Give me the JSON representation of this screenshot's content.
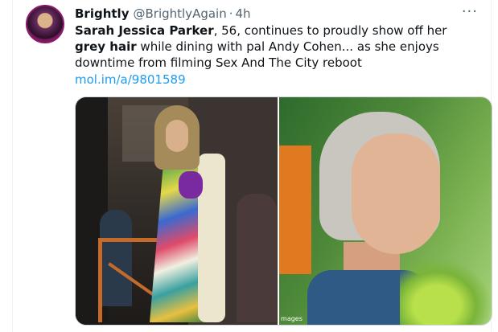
{
  "tweet": {
    "author_name": "Brightly",
    "author_handle": "@BrightlyAgain",
    "separator": "·",
    "timestamp": "4h",
    "more_label": "···",
    "text": {
      "p1_bold": "Sarah Jessica Parker",
      "p2": ", 56, continues to proudly show off her ",
      "p3_bold": "grey hair",
      "p4": " while dining with pal Andy Cohen... as she enjoys downtime from filming Sex And The City reboot"
    },
    "link": "mol.im/a/9801589",
    "media": {
      "credit": "mages"
    }
  }
}
